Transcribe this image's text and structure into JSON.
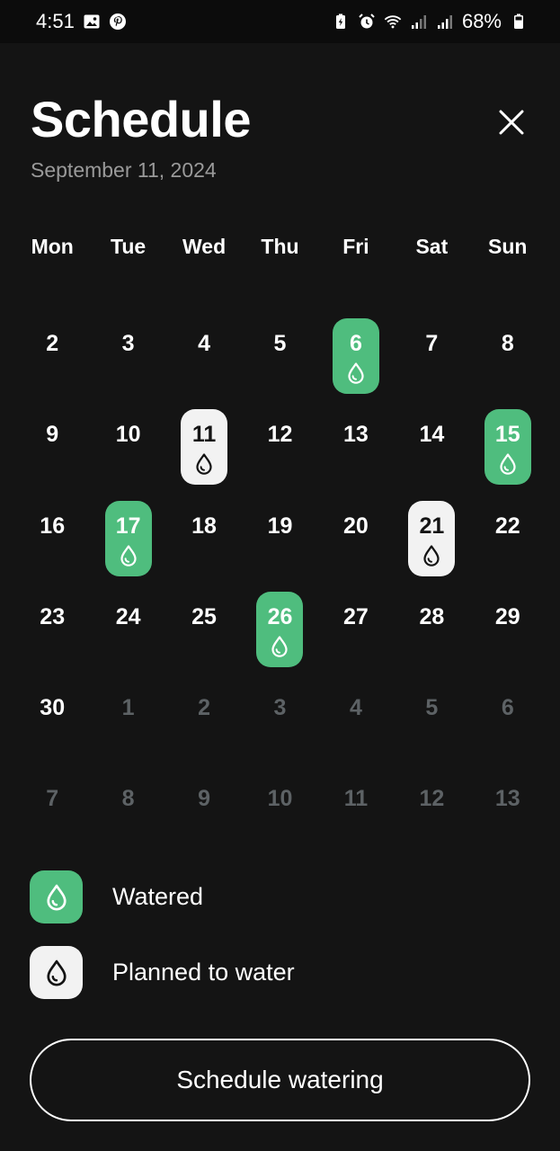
{
  "status_bar": {
    "time": "4:51",
    "battery_percent": "68%",
    "icons_left": [
      "image-icon",
      "pinterest-icon"
    ],
    "icons_right": [
      "battery-saver-icon",
      "alarm-icon",
      "wifi-icon",
      "signal-icon",
      "signal-icon",
      "battery-icon"
    ]
  },
  "header": {
    "title": "Schedule",
    "subtitle": "September 11, 2024",
    "close_icon": "close-icon"
  },
  "calendar": {
    "weekdays": [
      "Mon",
      "Tue",
      "Wed",
      "Thu",
      "Fri",
      "Sat",
      "Sun"
    ],
    "days": [
      {
        "n": "2"
      },
      {
        "n": "3"
      },
      {
        "n": "4"
      },
      {
        "n": "5"
      },
      {
        "n": "6",
        "status": "watered"
      },
      {
        "n": "7"
      },
      {
        "n": "8"
      },
      {
        "n": "9"
      },
      {
        "n": "10"
      },
      {
        "n": "11",
        "status": "planned"
      },
      {
        "n": "12"
      },
      {
        "n": "13"
      },
      {
        "n": "14"
      },
      {
        "n": "15",
        "status": "watered"
      },
      {
        "n": "16"
      },
      {
        "n": "17",
        "status": "watered"
      },
      {
        "n": "18"
      },
      {
        "n": "19"
      },
      {
        "n": "20"
      },
      {
        "n": "21",
        "status": "planned"
      },
      {
        "n": "22"
      },
      {
        "n": "23"
      },
      {
        "n": "24"
      },
      {
        "n": "25"
      },
      {
        "n": "26",
        "status": "watered"
      },
      {
        "n": "27"
      },
      {
        "n": "28"
      },
      {
        "n": "29"
      },
      {
        "n": "30"
      },
      {
        "n": "1",
        "other": true
      },
      {
        "n": "2",
        "other": true
      },
      {
        "n": "3",
        "other": true
      },
      {
        "n": "4",
        "other": true
      },
      {
        "n": "5",
        "other": true
      },
      {
        "n": "6",
        "other": true
      },
      {
        "n": "7",
        "other": true
      },
      {
        "n": "8",
        "other": true
      },
      {
        "n": "9",
        "other": true
      },
      {
        "n": "10",
        "other": true
      },
      {
        "n": "11",
        "other": true
      },
      {
        "n": "12",
        "other": true
      },
      {
        "n": "13",
        "other": true
      }
    ]
  },
  "legend": {
    "watered_label": "Watered",
    "planned_label": "Planned to water",
    "icon": "water-drop-icon"
  },
  "cta": {
    "label": "Schedule watering"
  },
  "colors": {
    "background": "#141414",
    "watered": "#4fbd7e",
    "planned": "#f2f2f2",
    "muted_text": "#9a9a9a",
    "other_month_text": "#5d6265"
  }
}
